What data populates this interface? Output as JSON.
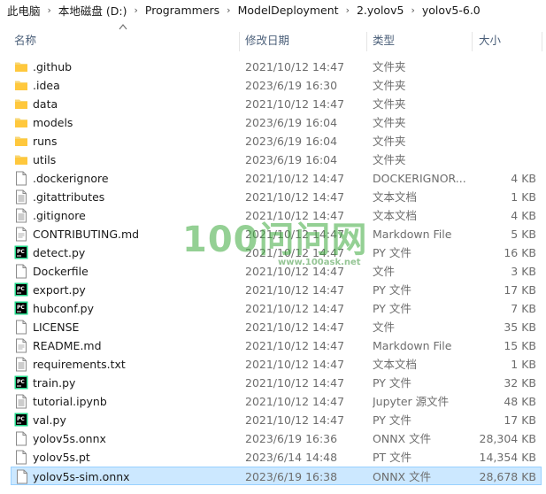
{
  "breadcrumb": [
    "此电脑",
    "本地磁盘 (D:)",
    "Programmers",
    "ModelDeployment",
    "2.yolov5",
    "yolov5-6.0"
  ],
  "columns": {
    "name": "名称",
    "date": "修改日期",
    "type": "类型",
    "size": "大小"
  },
  "watermark": {
    "big": "100问问网",
    "small": "www.100ask.net"
  },
  "files": [
    {
      "name": ".github",
      "date": "2021/10/12 14:47",
      "type": "文件夹",
      "size": "",
      "icon": "folder-icon"
    },
    {
      "name": ".idea",
      "date": "2023/6/19 16:30",
      "type": "文件夹",
      "size": "",
      "icon": "folder-icon"
    },
    {
      "name": "data",
      "date": "2021/10/12 14:47",
      "type": "文件夹",
      "size": "",
      "icon": "folder-icon"
    },
    {
      "name": "models",
      "date": "2023/6/19 16:04",
      "type": "文件夹",
      "size": "",
      "icon": "folder-icon"
    },
    {
      "name": "runs",
      "date": "2023/6/19 16:04",
      "type": "文件夹",
      "size": "",
      "icon": "folder-icon"
    },
    {
      "name": "utils",
      "date": "2023/6/19 16:04",
      "type": "文件夹",
      "size": "",
      "icon": "folder-icon"
    },
    {
      "name": ".dockerignore",
      "date": "2021/10/12 14:47",
      "type": "DOCKERIGNOR...",
      "size": "4 KB",
      "icon": "blank-file-icon"
    },
    {
      "name": ".gitattributes",
      "date": "2021/10/12 14:47",
      "type": "文本文档",
      "size": "1 KB",
      "icon": "text-file-icon"
    },
    {
      "name": ".gitignore",
      "date": "2021/10/12 14:47",
      "type": "文本文档",
      "size": "4 KB",
      "icon": "text-file-icon"
    },
    {
      "name": "CONTRIBUTING.md",
      "date": "2021/10/12 14:47",
      "type": "Markdown File",
      "size": "5 KB",
      "icon": "markdown-file-icon"
    },
    {
      "name": "detect.py",
      "date": "2021/10/12 14:47",
      "type": "PY 文件",
      "size": "16 KB",
      "icon": "pycharm-file-icon"
    },
    {
      "name": "Dockerfile",
      "date": "2021/10/12 14:47",
      "type": "文件",
      "size": "3 KB",
      "icon": "blank-file-icon"
    },
    {
      "name": "export.py",
      "date": "2021/10/12 14:47",
      "type": "PY 文件",
      "size": "17 KB",
      "icon": "pycharm-file-icon"
    },
    {
      "name": "hubconf.py",
      "date": "2021/10/12 14:47",
      "type": "PY 文件",
      "size": "7 KB",
      "icon": "pycharm-file-icon"
    },
    {
      "name": "LICENSE",
      "date": "2021/10/12 14:47",
      "type": "文件",
      "size": "35 KB",
      "icon": "blank-file-icon"
    },
    {
      "name": "README.md",
      "date": "2021/10/12 14:47",
      "type": "Markdown File",
      "size": "15 KB",
      "icon": "markdown-file-icon"
    },
    {
      "name": "requirements.txt",
      "date": "2021/10/12 14:47",
      "type": "文本文档",
      "size": "1 KB",
      "icon": "text-file-icon"
    },
    {
      "name": "train.py",
      "date": "2021/10/12 14:47",
      "type": "PY 文件",
      "size": "32 KB",
      "icon": "pycharm-file-icon"
    },
    {
      "name": "tutorial.ipynb",
      "date": "2021/10/12 14:47",
      "type": "Jupyter 源文件",
      "size": "48 KB",
      "icon": "text-file-icon"
    },
    {
      "name": "val.py",
      "date": "2021/10/12 14:47",
      "type": "PY 文件",
      "size": "17 KB",
      "icon": "pycharm-file-icon"
    },
    {
      "name": "yolov5s.onnx",
      "date": "2023/6/19 16:36",
      "type": "ONNX 文件",
      "size": "28,304 KB",
      "icon": "blank-file-icon"
    },
    {
      "name": "yolov5s.pt",
      "date": "2023/6/14 14:48",
      "type": "PT 文件",
      "size": "14,354 KB",
      "icon": "blank-file-icon"
    },
    {
      "name": "yolov5s-sim.onnx",
      "date": "2023/6/19 16:38",
      "type": "ONNX 文件",
      "size": "28,678 KB",
      "icon": "blank-file-icon",
      "selected": true
    }
  ]
}
